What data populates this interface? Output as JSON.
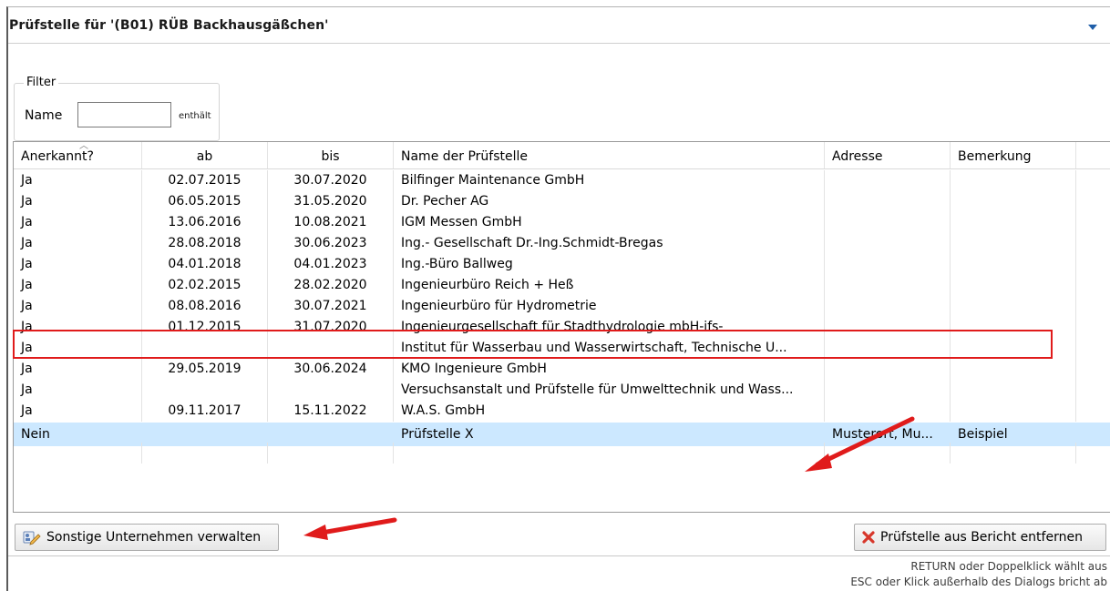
{
  "dialog": {
    "title": "Prüfstelle für '(B01) RÜB Backhausgäßchen'"
  },
  "filter": {
    "legend": "Filter",
    "name_label": "Name",
    "name_value": "",
    "contains_label": "enthält"
  },
  "table": {
    "columns": [
      "Anerkannt?",
      "ab",
      "bis",
      "Name der Prüfstelle",
      "Adresse",
      "Bemerkung"
    ],
    "rows": [
      [
        "Ja",
        "02.07.2015",
        "30.07.2020",
        "Bilfinger Maintenance  GmbH",
        "",
        ""
      ],
      [
        "Ja",
        "06.05.2015",
        "31.05.2020",
        "Dr. Pecher AG",
        "",
        ""
      ],
      [
        "Ja",
        "13.06.2016",
        "10.08.2021",
        "IGM Messen GmbH",
        "",
        ""
      ],
      [
        "Ja",
        "28.08.2018",
        "30.06.2023",
        "Ing.- Gesellschaft Dr.-Ing.Schmidt-Bregas",
        "",
        ""
      ],
      [
        "Ja",
        "04.01.2018",
        "04.01.2023",
        "Ing.-Büro Ballweg",
        "",
        ""
      ],
      [
        "Ja",
        "02.02.2015",
        "28.02.2020",
        "Ingenieurbüro Reich + Heß",
        "",
        ""
      ],
      [
        "Ja",
        "08.08.2016",
        "30.07.2021",
        "Ingenieurbüro für Hydrometrie",
        "",
        ""
      ],
      [
        "Ja",
        "01.12.2015",
        "31.07.2020",
        "Ingenieurgesellschaft für Stadthydrologie mbH-ifs-",
        "",
        ""
      ],
      [
        "Ja",
        "",
        "",
        "Institut für Wasserbau und Wasserwirtschaft, Technische U...",
        "",
        ""
      ],
      [
        "Ja",
        "29.05.2019",
        "30.06.2024",
        "KMO Ingenieure GmbH",
        "",
        ""
      ],
      [
        "Ja",
        "",
        "",
        "Versuchsanstalt und Prüfstelle für Umwelttechnik und Wass...",
        "",
        ""
      ],
      [
        "Ja",
        "09.11.2017",
        "15.11.2022",
        "W.A.S. GmbH",
        "",
        ""
      ],
      [
        "Nein",
        "",
        "",
        "Prüfstelle X",
        "Musterort, Mu...",
        "Beispiel"
      ]
    ],
    "selected_row": 12
  },
  "buttons": {
    "manage": "Sonstige Unternehmen verwalten",
    "remove": "Prüfstelle aus Bericht entfernen"
  },
  "hints": {
    "line1": "RETURN oder Doppelklick wählt aus",
    "line2": "ESC oder Klick außerhalb des Dialogs bricht ab"
  },
  "colors": {
    "selection": "#cce8ff",
    "annotation": "#e01b1b",
    "accent": "#1f5ea8"
  }
}
